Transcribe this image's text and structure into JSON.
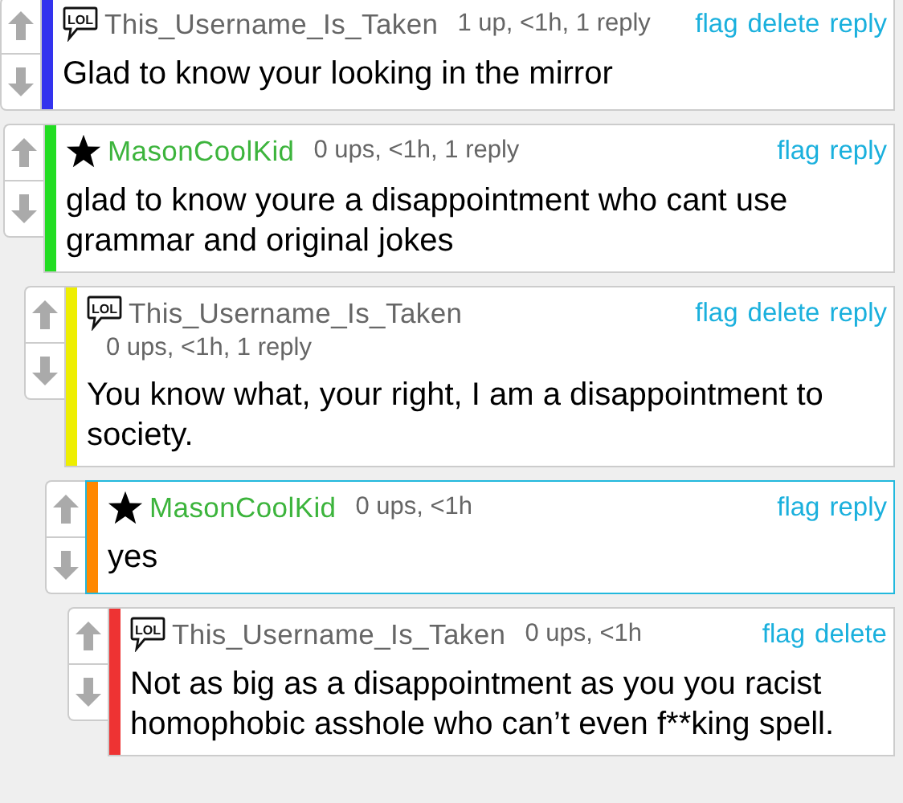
{
  "comments": [
    {
      "user": "This_Username_Is_Taken",
      "kind": "lol",
      "badge_text": "LOL",
      "meta": "1 up, <1h, 1 reply",
      "actions": [
        "flag",
        "delete",
        "reply"
      ],
      "color": "#3333ee",
      "highlighted": false,
      "text": "Glad to know your looking in the mirror",
      "children": [
        {
          "user": "MasonCoolKid",
          "kind": "star",
          "meta": "0 ups, <1h, 1 reply",
          "actions": [
            "flag",
            "reply"
          ],
          "color": "#22dd22",
          "highlighted": false,
          "text": "glad to know youre a disappointment who cant use grammar and original jokes",
          "children": [
            {
              "user": "This_Username_Is_Taken",
              "kind": "lol",
              "badge_text": "LOL",
              "meta": "0 ups, <1h, 1 reply",
              "actions": [
                "flag",
                "delete",
                "reply"
              ],
              "color": "#eeee00",
              "highlighted": false,
              "text": "You know what, your right, I am a disappointment to society.",
              "children": [
                {
                  "user": "MasonCoolKid",
                  "kind": "star",
                  "meta": "0 ups, <1h",
                  "actions": [
                    "flag",
                    "reply"
                  ],
                  "color": "#ff8800",
                  "highlighted": true,
                  "text": "yes",
                  "children": [
                    {
                      "user": "This_Username_Is_Taken",
                      "kind": "lol",
                      "badge_text": "LOL",
                      "meta": "0 ups, <1h",
                      "actions": [
                        "flag",
                        "delete"
                      ],
                      "color": "#ee3333",
                      "highlighted": false,
                      "text": "Not as big as a disappointment as you you racist homophobic asshole who can’t even f**king spell."
                    }
                  ]
                }
              ]
            }
          ]
        }
      ]
    }
  ]
}
